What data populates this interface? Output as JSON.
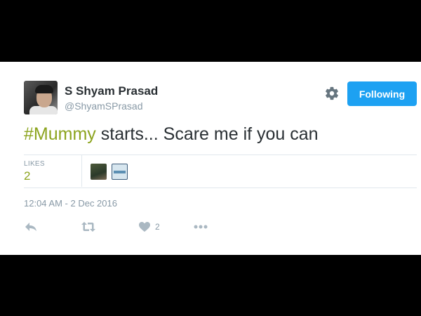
{
  "tweet": {
    "author_name": "S Shyam Prasad",
    "author_handle": "@ShyamSPrasad",
    "follow_label": "Following",
    "text_hashtag": "#Mummy",
    "text_body": " starts... Scare me if you can",
    "likes_label": "LIKES",
    "likes_count": "2",
    "timestamp": "12:04 AM - 2 Dec 2016",
    "action_like_count": "2"
  },
  "icons": {
    "settings": "gear-icon",
    "reply": "reply-icon",
    "retweet": "retweet-icon",
    "like": "heart-icon",
    "more": "more-dots-icon"
  },
  "colors": {
    "background": "#000000",
    "card": "#ffffff",
    "accent_blue": "#1da1f2",
    "hashtag_green": "#8ca41e",
    "muted_text": "#8899a6",
    "primary_text": "#292f33",
    "icon_gray": "#aab8c2"
  }
}
